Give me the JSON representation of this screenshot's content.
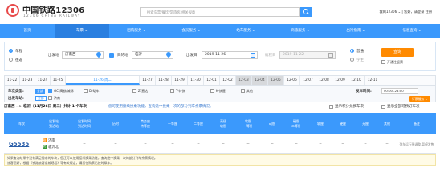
{
  "header": {
    "logo_cn": "中国铁路12306",
    "logo_en": "12306 CHINA RAILWAY",
    "search_placeholder": "搜索车票/餐饮/常旅客/相关规章",
    "top_links": "我的12306 ⌄ | 您好，请登录 注册"
  },
  "nav": [
    {
      "label": "首页"
    },
    {
      "label": "车票 ⌄",
      "active": true
    },
    {
      "label": "团购服务 ⌄"
    },
    {
      "label": "会员服务 ⌄"
    },
    {
      "label": "站车服务 ⌄"
    },
    {
      "label": "商旅服务 ⌄"
    },
    {
      "label": "出行指南 ⌄"
    },
    {
      "label": "信息查询 ⌄"
    }
  ],
  "query": {
    "trip_oneway": "单程",
    "trip_round": "往返",
    "from_label": "出发地",
    "from_value": "济南西",
    "to_label": "目的地",
    "to_value": "临沂",
    "depart_label": "出发日",
    "depart_value": "2019-11-26",
    "return_label": "返程日",
    "return_value": "2019-11-22",
    "type_normal": "普通",
    "type_student": "学生",
    "resale_label": "开通往返票",
    "query_button": "查询"
  },
  "dates": [
    "11-22",
    "11-23",
    "11-24",
    "11-25",
    "11-26 周二",
    "11-27",
    "11-28",
    "11-29",
    "11-30",
    "12-01",
    "12-02",
    "12-03",
    "12-04",
    "12-05",
    "12-06",
    "12-07",
    "12-08",
    "12-09",
    "12-10",
    "12-11"
  ],
  "filters": {
    "type_label": "车次类型:",
    "type_all": "全部",
    "types": [
      "GC-高铁/城际",
      "D-动车",
      "Z-直达",
      "T-特快",
      "K-快速",
      "其他"
    ],
    "station_label": "出发车站:",
    "station_all": "全部",
    "station_value": "济南",
    "time_label": "发车时间:",
    "time_value": "00:00--24:00",
    "order_button": "订票服务 ⌄"
  },
  "summary": {
    "route": "济南西 --> 临沂（11月26日 周二）共计 1 个车次",
    "hint": "您可使用接续换乘功能，查询途中换乘一次的部分列车余票情况。",
    "opt_sellout": "显示积分兑换车次",
    "opt_all": "显示全部可预订车次"
  },
  "table_headers": [
    "车次",
    "出发站\n到达站",
    "出发时间\n到达时间",
    "历时",
    "商务座\n特等座",
    "一等座",
    "二等座",
    "高级\n软卧",
    "软卧\n一等卧",
    "动卧",
    "硬卧\n二等卧",
    "软座",
    "硬座",
    "无座",
    "其他",
    "备注"
  ],
  "trains": [
    {
      "code": "G5535",
      "from_station": "济南",
      "to_station": "临沂北",
      "from_badge": "始",
      "to_badge": "终",
      "depart": "--",
      "arrive": "--",
      "duration": "--",
      "cells": [
        "--",
        "--",
        "--",
        "--",
        "--",
        "--",
        "--",
        "--",
        "--",
        "--",
        "--"
      ],
      "remark": "列车运行图调整,暂停发售"
    }
  ],
  "notice": "如果查询结果中没有满足需求的车次，您还可以使用接续换乘功能，查询途中换乘一次的部分列车余票情况。\n旅客您好，根据《铁路旅客运输规程》等有关规定，请您在购票后按时乘车。",
  "colors": {
    "brand_blue": "#3b99fc",
    "accent_orange": "#ff8a00",
    "logo_red": "#e84b4b"
  }
}
